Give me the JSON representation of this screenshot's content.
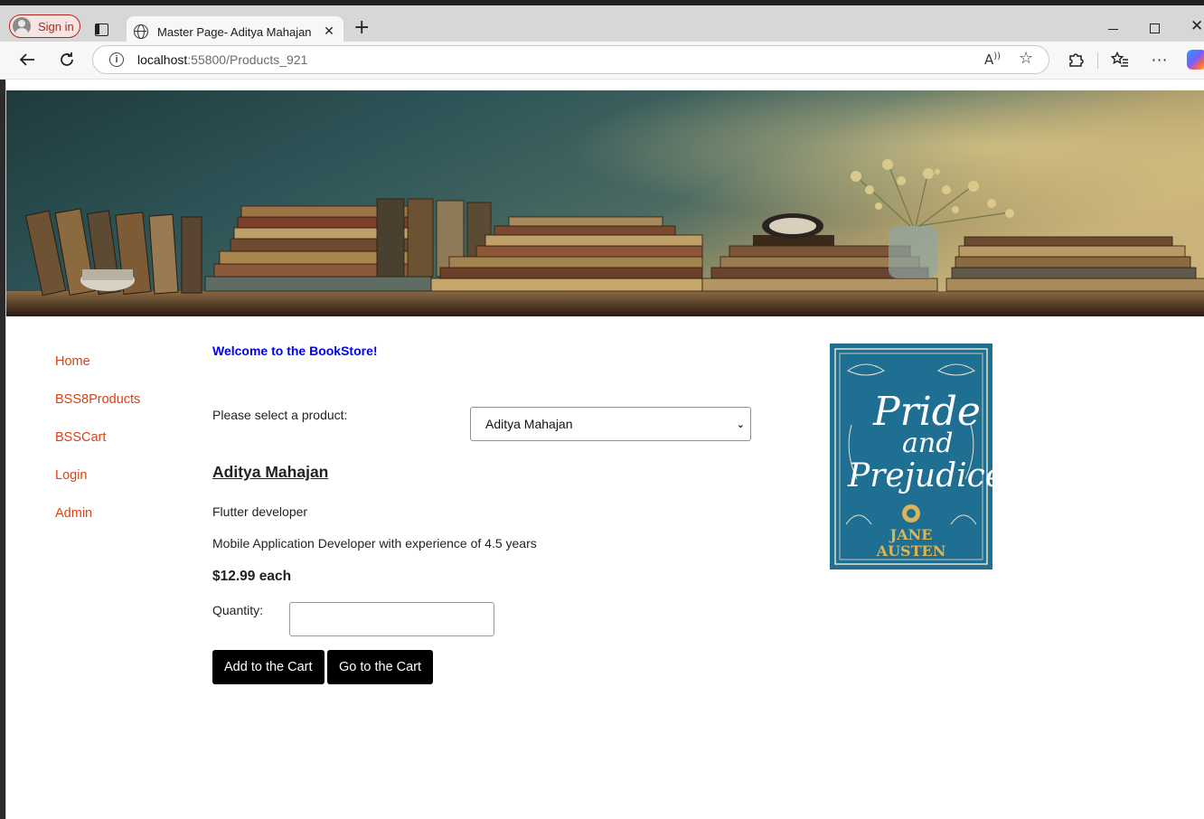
{
  "browser": {
    "profile_label": "Sign in",
    "tab_title": "Master Page- Aditya Mahajan",
    "tab_close": "✕",
    "new_tab": "+",
    "url_host": "localhost",
    "url_path": ":55800/Products_921"
  },
  "nav": {
    "items": [
      {
        "label": "Home"
      },
      {
        "label": "BSS8Products"
      },
      {
        "label": "BSSCart"
      },
      {
        "label": "Login"
      },
      {
        "label": "Admin"
      }
    ]
  },
  "main": {
    "welcome": "Welcome to the BookStore!",
    "select_label": "Please select a product:",
    "selected_product": "Aditya Mahajan",
    "product_name": "Aditya Mahajan",
    "short_description": "Flutter developer",
    "long_description": "Mobile Application Developer with experience of 4.5 years",
    "price": "$12.99 each",
    "quantity_label": "Quantity:",
    "quantity_value": "",
    "add_button": "Add to the Cart",
    "go_button": "Go to the Cart"
  },
  "cover": {
    "title_line1": "Pride",
    "title_line2": "and",
    "title_line3": "Prejudice",
    "author_line1": "JANE",
    "author_line2": "AUSTEN",
    "background": "#1e6f92",
    "accent": "#d9b45a"
  },
  "colors": {
    "nav_link": "#d84315",
    "welcome": "#0000ee",
    "button_bg": "#000000",
    "profile_accent": "#b3261e"
  }
}
